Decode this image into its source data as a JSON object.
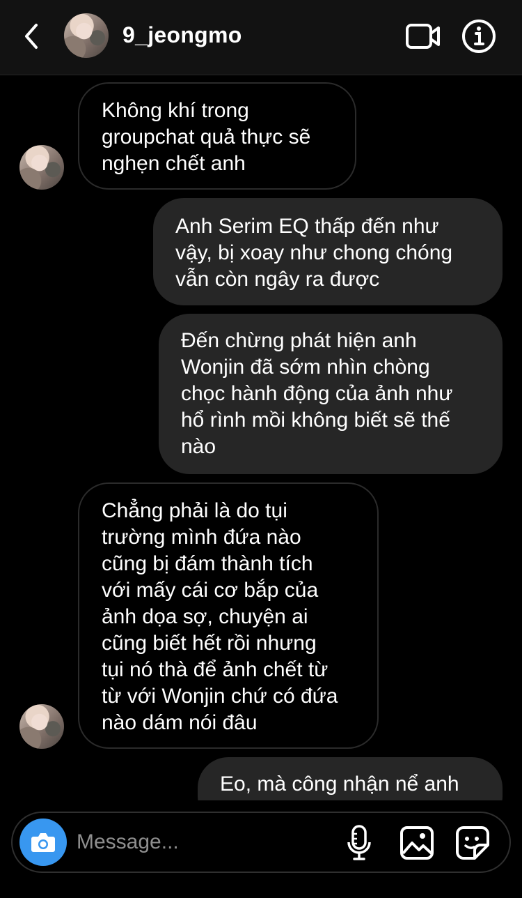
{
  "header": {
    "username": "9_jeongmo",
    "back_icon": "chevron-left-icon",
    "video_icon": "video-camera-icon",
    "info_icon": "info-icon"
  },
  "messages": [
    {
      "direction": "received",
      "text": "Không khí trong\ngroupchat quả thực sẽ\nnghẹn chết anh"
    },
    {
      "direction": "sent",
      "text": "Anh Serim EQ thấp đến như\nvậy, bị xoay như chong chóng\nvẫn còn ngây ra được"
    },
    {
      "direction": "sent",
      "text": "Đến chừng phát hiện anh\nWonjin đã sớm nhìn chòng\nchọc hành động của ảnh như\nhổ rình mồi không biết sẽ thế\nnào"
    },
    {
      "direction": "received",
      "text": "Chẳng phải là do tụi\ntrường mình đứa nào\ncũng bị đám thành tích\nvới mấy cái cơ bắp của\nảnh dọa sợ, chuyện ai\ncũng biết hết rồi nhưng\ntụi nó thà để ảnh chết từ\ntừ với Wonjin chứ có đứa\nnào dám nói đâu"
    },
    {
      "direction": "sent",
      "text": "Eo, mà công nhận nể anh"
    }
  ],
  "composer": {
    "placeholder": "Message...",
    "camera_icon": "camera-icon",
    "mic_icon": "microphone-icon",
    "gallery_icon": "image-icon",
    "sticker_icon": "sticker-icon"
  },
  "colors": {
    "background": "#000000",
    "header_bg": "#121212",
    "sent_bubble": "#262626",
    "received_border": "#2b2b2b",
    "accent": "#3897f0",
    "placeholder": "#8e8e8e"
  }
}
